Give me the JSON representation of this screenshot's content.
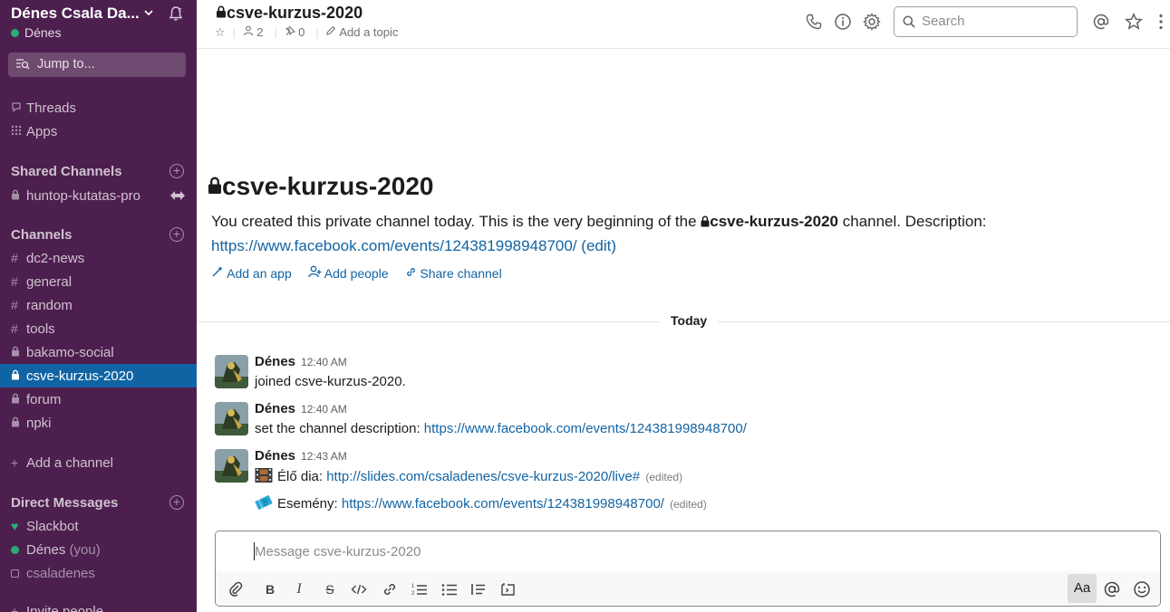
{
  "workspace": {
    "name": "Dénes Csala Da...",
    "user": "Dénes"
  },
  "jump_to": "Jump to...",
  "sidebar": {
    "nav": [
      {
        "label": "Threads"
      },
      {
        "label": "Apps"
      }
    ],
    "shared_header": "Shared Channels",
    "shared": [
      {
        "label": "huntop-kutatas-pro"
      }
    ],
    "channels_header": "Channels",
    "channels": [
      {
        "label": "dc2-news",
        "prefix": "#"
      },
      {
        "label": "general",
        "prefix": "#"
      },
      {
        "label": "random",
        "prefix": "#"
      },
      {
        "label": "tools",
        "prefix": "#"
      },
      {
        "label": "bakamo-social",
        "prefix": "lock"
      },
      {
        "label": "csve-kurzus-2020",
        "prefix": "lock",
        "active": true
      },
      {
        "label": "forum",
        "prefix": "lock"
      },
      {
        "label": "npki",
        "prefix": "lock"
      }
    ],
    "add_channel": "Add a channel",
    "dm_header": "Direct Messages",
    "dms": [
      {
        "label": "Slackbot"
      },
      {
        "label": "Dénes",
        "suffix": "(you)"
      },
      {
        "label": "csaladenes"
      }
    ],
    "invite": "Invite people"
  },
  "header": {
    "title": "csve-kurzus-2020",
    "members": "2",
    "pins": "0",
    "add_topic": "Add a topic",
    "search_placeholder": "Search"
  },
  "intro": {
    "title": "csve-kurzus-2020",
    "text_before": "You created this private channel today. This is the very beginning of the ",
    "channel": "csve-kurzus-2020",
    "text_after": " channel. Description:",
    "link": "https://www.facebook.com/events/124381998948700/",
    "edit": "(edit)",
    "actions": {
      "add_app": "Add an app",
      "add_people": "Add people",
      "share": "Share channel"
    }
  },
  "day_divider": "Today",
  "messages": [
    {
      "author": "Dénes",
      "time": "12:40 AM",
      "text": "joined csve-kurzus-2020."
    },
    {
      "author": "Dénes",
      "time": "12:40 AM",
      "text": "set the channel description: ",
      "link": "https://www.facebook.com/events/124381998948700/"
    },
    {
      "author": "Dénes",
      "time": "12:43 AM",
      "line1_label": "Élő dia: ",
      "line1_link": "http://slides.com/csaladenes/csve-kurzus-2020/live#",
      "line2_label": "Esemény: ",
      "line2_link": "https://www.facebook.com/events/124381998948700/",
      "edited": "(edited)"
    }
  ],
  "composer": {
    "placeholder": "Message csve-kurzus-2020",
    "aa_label": "Aa"
  },
  "colors": {
    "sidebar_bg": "#4d1f4f",
    "active": "#1164a3",
    "link": "#1264a3",
    "presence": "#2bac76"
  }
}
